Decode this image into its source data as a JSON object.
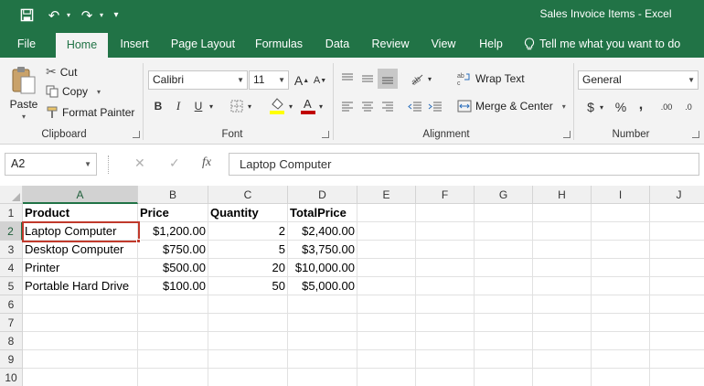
{
  "window": {
    "title": "Sales Invoice Items  -  Excel"
  },
  "quick_access": [
    {
      "name": "save-icon",
      "glyph": "💾"
    },
    {
      "name": "undo-icon",
      "glyph": "↶"
    },
    {
      "name": "redo-icon",
      "glyph": "↷"
    },
    {
      "name": "customize-qat-icon",
      "glyph": "▾"
    }
  ],
  "tabs": [
    "File",
    "Home",
    "Insert",
    "Page Layout",
    "Formulas",
    "Data",
    "Review",
    "View",
    "Help"
  ],
  "active_tab": "Home",
  "tell_me": "Tell me what you want to do",
  "ribbon": {
    "clipboard": {
      "paste": "Paste",
      "cut": "Cut",
      "copy": "Copy",
      "format_painter": "Format Painter",
      "label": "Clipboard"
    },
    "font": {
      "name": "Calibri",
      "size": "11",
      "label": "Font",
      "bold": "B",
      "italic": "I",
      "underline": "U",
      "grow": "A",
      "shrink": "A"
    },
    "alignment": {
      "wrap_text": "Wrap Text",
      "merge_center": "Merge & Center",
      "label": "Alignment"
    },
    "number": {
      "format": "General",
      "label": "Number",
      "currency": "$",
      "percent": "%",
      "comma": ",",
      "inc_decimal": ".00",
      "dec_decimal": ".0"
    }
  },
  "formula_bar": {
    "name_box": "A2",
    "fx": "fx",
    "content": "Laptop Computer"
  },
  "sheet": {
    "columns": [
      "A",
      "B",
      "C",
      "D",
      "E",
      "F",
      "G",
      "H",
      "I",
      "J"
    ],
    "row_numbers": [
      "1",
      "2",
      "3",
      "4",
      "5",
      "6",
      "7",
      "8",
      "9",
      "10"
    ],
    "selected_cell": "A2",
    "rows": [
      [
        "Product",
        "Price",
        "Quantity",
        "TotalPrice"
      ],
      [
        "Laptop Computer",
        "$1,200.00",
        "2",
        "$2,400.00"
      ],
      [
        "Desktop Computer",
        "$750.00",
        "5",
        "$3,750.00"
      ],
      [
        "Printer",
        "$500.00",
        "20",
        "$10,000.00"
      ],
      [
        "Portable Hard Drive",
        "$100.00",
        "50",
        "$5,000.00"
      ]
    ]
  },
  "colors": {
    "excel_green": "#217346",
    "selection_border": "#c0392b",
    "font_color_bar": "#c00000",
    "highlight_bar": "#ffff00"
  }
}
